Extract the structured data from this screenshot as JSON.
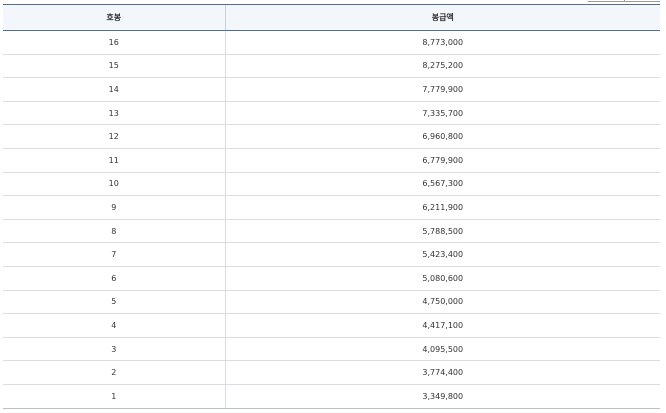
{
  "table": {
    "headers": [
      "호봉",
      "봉급액"
    ],
    "rows": [
      {
        "grade": "16",
        "salary": "8,773,000"
      },
      {
        "grade": "15",
        "salary": "8,275,200"
      },
      {
        "grade": "14",
        "salary": "7,779,900"
      },
      {
        "grade": "13",
        "salary": "7,335,700"
      },
      {
        "grade": "12",
        "salary": "6,960,800"
      },
      {
        "grade": "11",
        "salary": "6,779,900"
      },
      {
        "grade": "10",
        "salary": "6,567,300"
      },
      {
        "grade": "9",
        "salary": "6,211,900"
      },
      {
        "grade": "8",
        "salary": "5,788,500"
      },
      {
        "grade": "7",
        "salary": "5,423,400"
      },
      {
        "grade": "6",
        "salary": "5,080,600"
      },
      {
        "grade": "5",
        "salary": "4,750,000"
      },
      {
        "grade": "4",
        "salary": "4,417,100"
      },
      {
        "grade": "3",
        "salary": "4,095,500"
      },
      {
        "grade": "2",
        "salary": "3,774,400"
      },
      {
        "grade": "1",
        "salary": "3,349,800"
      }
    ]
  }
}
